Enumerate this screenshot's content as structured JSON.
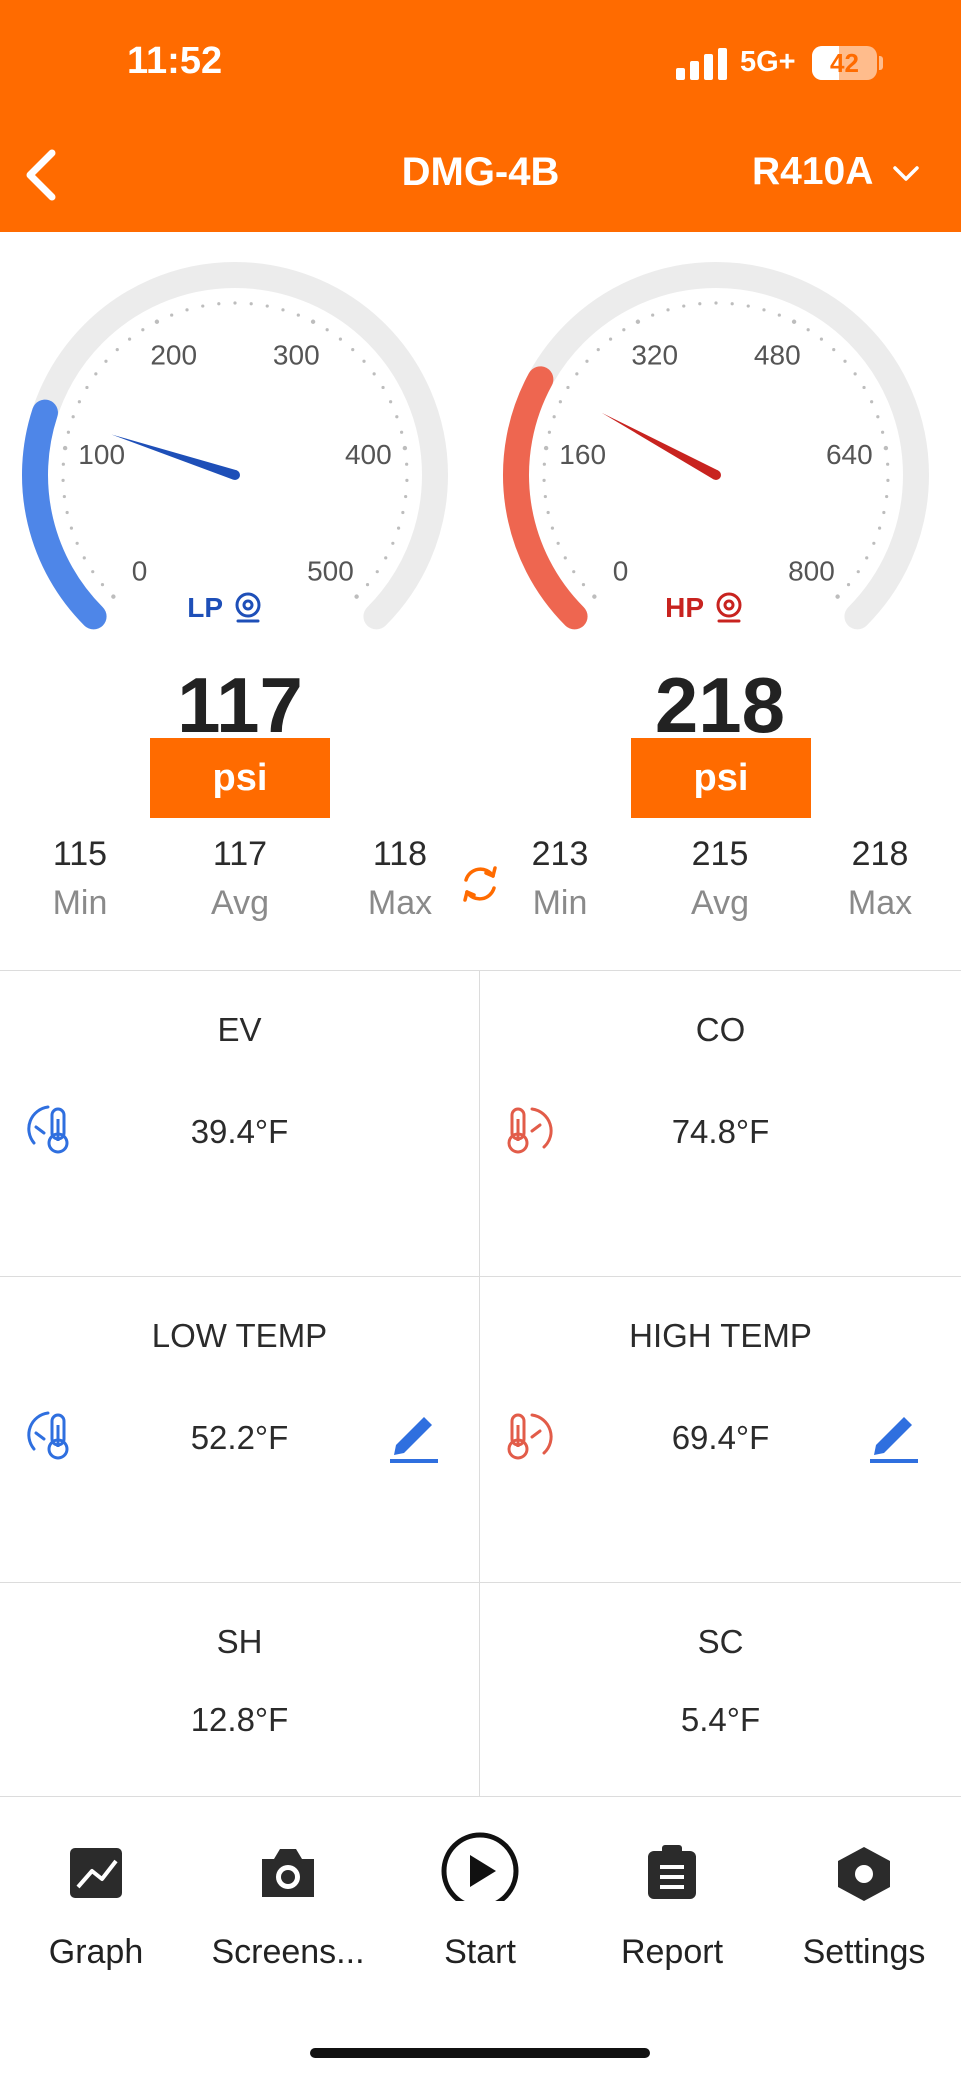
{
  "status_bar": {
    "time": "11:52",
    "network": "5G+",
    "battery": "42",
    "battery_level": 0.42
  },
  "header": {
    "title": "DMG-4B",
    "refrigerant": "R410A"
  },
  "gauges": {
    "lp": {
      "label": "LP",
      "ticks": [
        "0",
        "100",
        "200",
        "300",
        "400",
        "500"
      ],
      "value": "117",
      "unit": "psi",
      "min": "115",
      "avg": "117",
      "max": "118",
      "min_label": "Min",
      "avg_label": "Avg",
      "max_label": "Max",
      "color": "#4e86e8",
      "needle_color": "#1e4fb8"
    },
    "hp": {
      "label": "HP",
      "ticks": [
        "0",
        "160",
        "320",
        "480",
        "640",
        "800"
      ],
      "value": "218",
      "unit": "psi",
      "min": "213",
      "avg": "215",
      "max": "218",
      "min_label": "Min",
      "avg_label": "Avg",
      "max_label": "Max",
      "color": "#ee6650",
      "needle_color": "#c8231f"
    }
  },
  "readings": {
    "ev": {
      "title": "EV",
      "value": "39.4°F"
    },
    "co": {
      "title": "CO",
      "value": "74.8°F"
    },
    "low_temp": {
      "title": "LOW TEMP",
      "value": "52.2°F"
    },
    "high_temp": {
      "title": "HIGH TEMP",
      "value": "69.4°F"
    },
    "sh": {
      "title": "SH",
      "value": "12.8°F"
    },
    "sc": {
      "title": "SC",
      "value": "5.4°F"
    }
  },
  "bottom_nav": [
    {
      "label": "Graph",
      "icon": "graph-icon"
    },
    {
      "label": "Screens...",
      "icon": "camera-icon"
    },
    {
      "label": "Start",
      "icon": "play-icon"
    },
    {
      "label": "Report",
      "icon": "clipboard-icon"
    },
    {
      "label": "Settings",
      "icon": "settings-icon"
    }
  ],
  "colors": {
    "accent": "#ff6b00",
    "blue": "#2f6fdf",
    "red": "#e25c49"
  }
}
